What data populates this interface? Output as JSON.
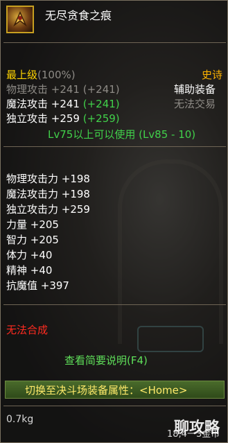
{
  "item": {
    "name": "无尽贪食之痕",
    "icon": "item-emblem-icon",
    "grade": "最上级",
    "grade_percent": "(100%)",
    "rarity": "史诗",
    "equip_type": "辅助装备",
    "trade": "无法交易",
    "phys_attack": "物理攻击 +241 (+241)",
    "magic_attack_label": "魔法攻击 +241",
    "magic_attack_bonus": "(+241)",
    "indep_attack_label": "独立攻击 +259",
    "indep_attack_bonus": "(+259)",
    "level_req": "Lv75以上可以使用 (Lv85 - 10)",
    "stats": [
      "物理攻击力 +198",
      "魔法攻击力 +198",
      "独立攻击力 +259",
      "力量 +205",
      "智力 +205",
      "体力 +40",
      "精神 +40",
      "抗魔值 +397"
    ],
    "cannot_synthesize": "无法合成",
    "view_brief": "查看简要说明(F4)",
    "switch_arena": "切换至决斗场装备属性：<Home>",
    "weight": "0.7kg",
    "price": "18,4一3金币",
    "watermark": "聊攻略"
  },
  "colors": {
    "border": "#c8a020",
    "epic": "#ffb400",
    "green": "#41d14a",
    "red": "#ff2b20",
    "grade_yellow": "#ffd400"
  }
}
